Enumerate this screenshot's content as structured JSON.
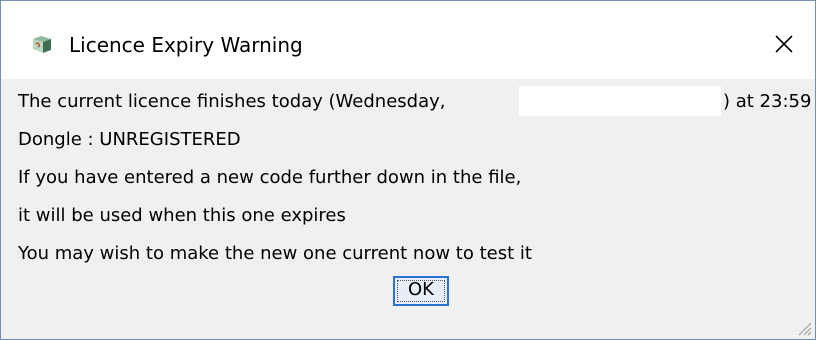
{
  "window": {
    "title": "Licence Expiry Warning",
    "icon": "java-cup-icon",
    "close_glyph": "✕"
  },
  "message": {
    "line1_prefix": "The current licence finishes today (Wednesday,",
    "line1_suffix": ") at 23:59",
    "line2": "Dongle : UNREGISTERED",
    "line3": "If you have entered a new code further down in the file,",
    "line4": "it will be used when this one expires",
    "line5": "You may wish to make the new one current now to test it"
  },
  "buttons": {
    "ok_label": "OK"
  },
  "colors": {
    "focus_border": "#2a72d4",
    "dialog_background": "#f0f0f0",
    "title_background": "#ffffff"
  }
}
